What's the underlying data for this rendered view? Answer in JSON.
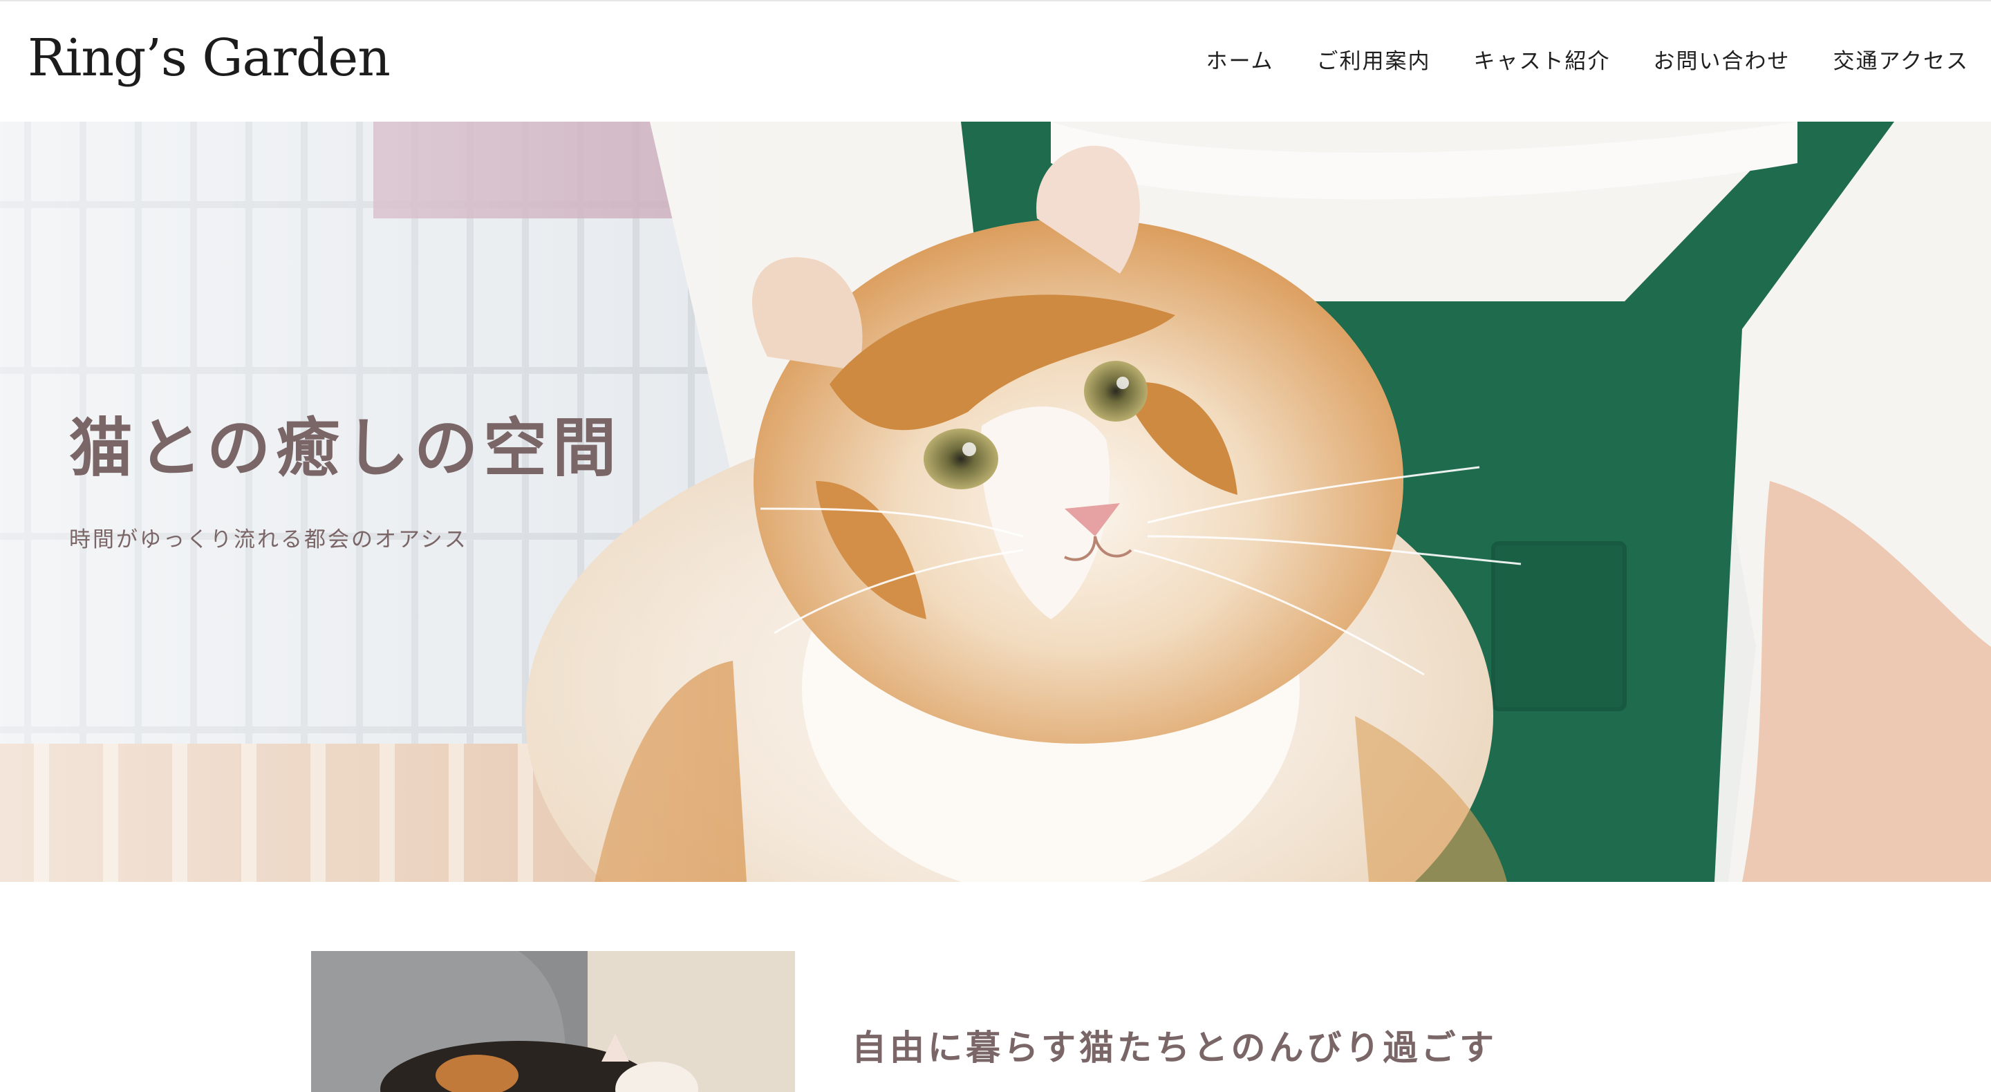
{
  "site": {
    "logo": "Ring’s Garden"
  },
  "nav": {
    "items": [
      {
        "label": "ホーム"
      },
      {
        "label": "ご利用案内"
      },
      {
        "label": "キャスト紹介"
      },
      {
        "label": "お問い合わせ"
      },
      {
        "label": "交通アクセス"
      }
    ]
  },
  "hero": {
    "title": "猫との癒しの空間",
    "subtitle": "時間がゆっくり流れる都会のオアシス"
  },
  "intro": {
    "heading": "自由に暮らす猫たちとのんびり過ごす"
  },
  "colors": {
    "text_accent": "#7a6567",
    "apron_green": "#1f6b4e",
    "cat_orange": "#d9954a",
    "cat_white": "#f7f1ea"
  }
}
